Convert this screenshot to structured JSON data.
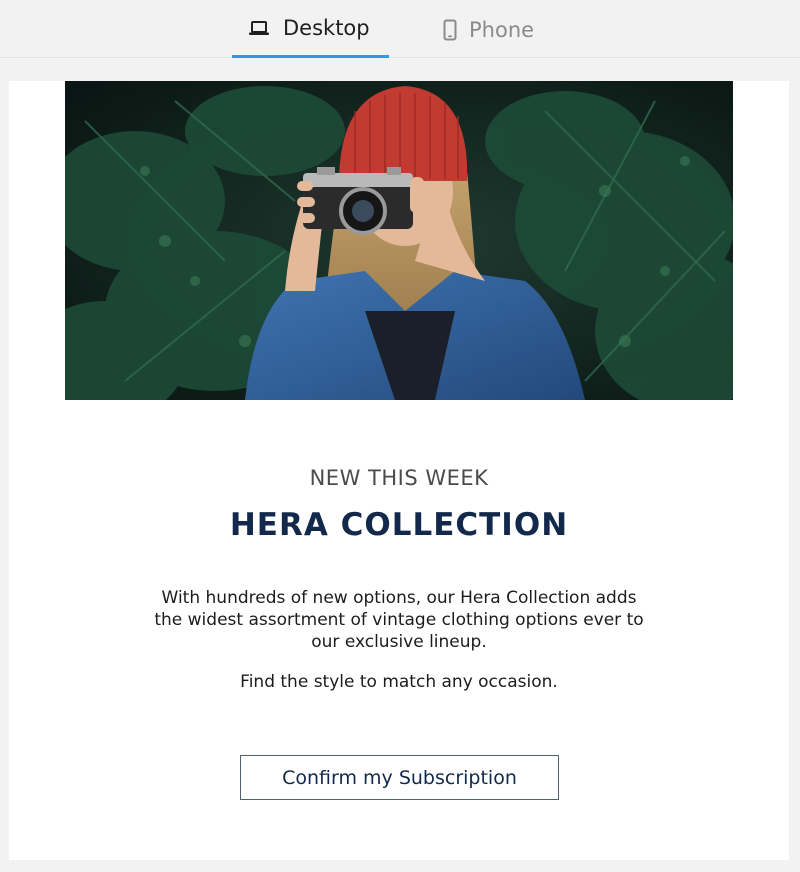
{
  "tabs": {
    "desktop": {
      "label": "Desktop",
      "icon": "laptop-icon",
      "active": true
    },
    "phone": {
      "label": "Phone",
      "icon": "phone-icon",
      "active": false
    },
    "accent_color": "#2e9be6"
  },
  "email": {
    "hero_image": "woman-with-camera-photo",
    "eyebrow": "NEW THIS WEEK",
    "headline": "HERA COLLECTION",
    "body": "With hundreds of new options, our Hera Collection adds the widest assortment of vintage clothing options ever to our exclusive lineup.",
    "tagline": "Find the style to match any occasion.",
    "cta_label": "Confirm my Subscription",
    "headline_color": "#13294b"
  }
}
